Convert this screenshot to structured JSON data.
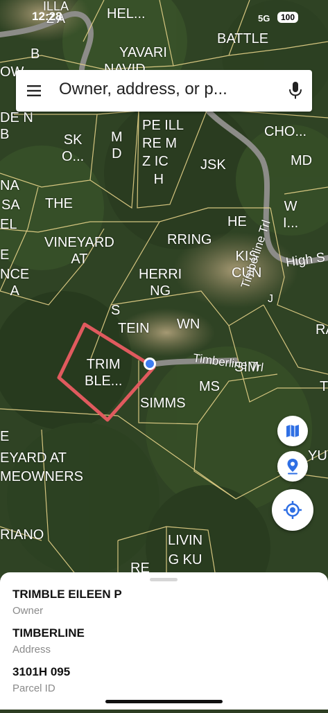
{
  "status_bar": {
    "time": "12:28",
    "network": "5G",
    "battery": "100"
  },
  "search": {
    "placeholder": "Owner, address, or p..."
  },
  "map": {
    "parcel_labels": [
      "ILLA\nZ A",
      "HEL...",
      "BATTLE",
      "B",
      "YAVARI",
      "NAVID",
      "OW",
      "DE N",
      "B",
      "PE ILL\nRE M\nZ IC\n   H",
      "CHO...",
      "SK\nO...",
      "M\nD",
      "JSK",
      "MD",
      "NA",
      "SA",
      "EL",
      "THE",
      "W\nI...",
      "HE",
      "VINEYARD\nAT",
      "RRING",
      "E",
      "NCE\nA",
      "HERRI\nNG",
      "KIS\nCUN",
      "S",
      "TEIN",
      "WN",
      "J",
      "RA",
      "TRIM\nBLE...",
      "SIM",
      "MS",
      "SIMMS",
      "T",
      "E",
      "EYARD AT\nMEOWNERS",
      "YUK",
      "RIANO",
      "LIVIN\nG KU",
      "RE"
    ],
    "road_labels": [
      "Timberline Trl",
      "High S"
    ],
    "selected_parcel_color": "#e05a5e",
    "parcel_line_color": "#e8d48a"
  },
  "controls": {
    "layers": "map-icon",
    "pin": "location-pin-icon",
    "locate": "my-location-icon"
  },
  "parcel_info": {
    "owner_value": "TRIMBLE EILEEN P",
    "owner_caption": "Owner",
    "address_value": "TIMBERLINE",
    "address_caption": "Address",
    "parcel_id_value": "3101H  095",
    "parcel_id_caption": "Parcel ID"
  }
}
